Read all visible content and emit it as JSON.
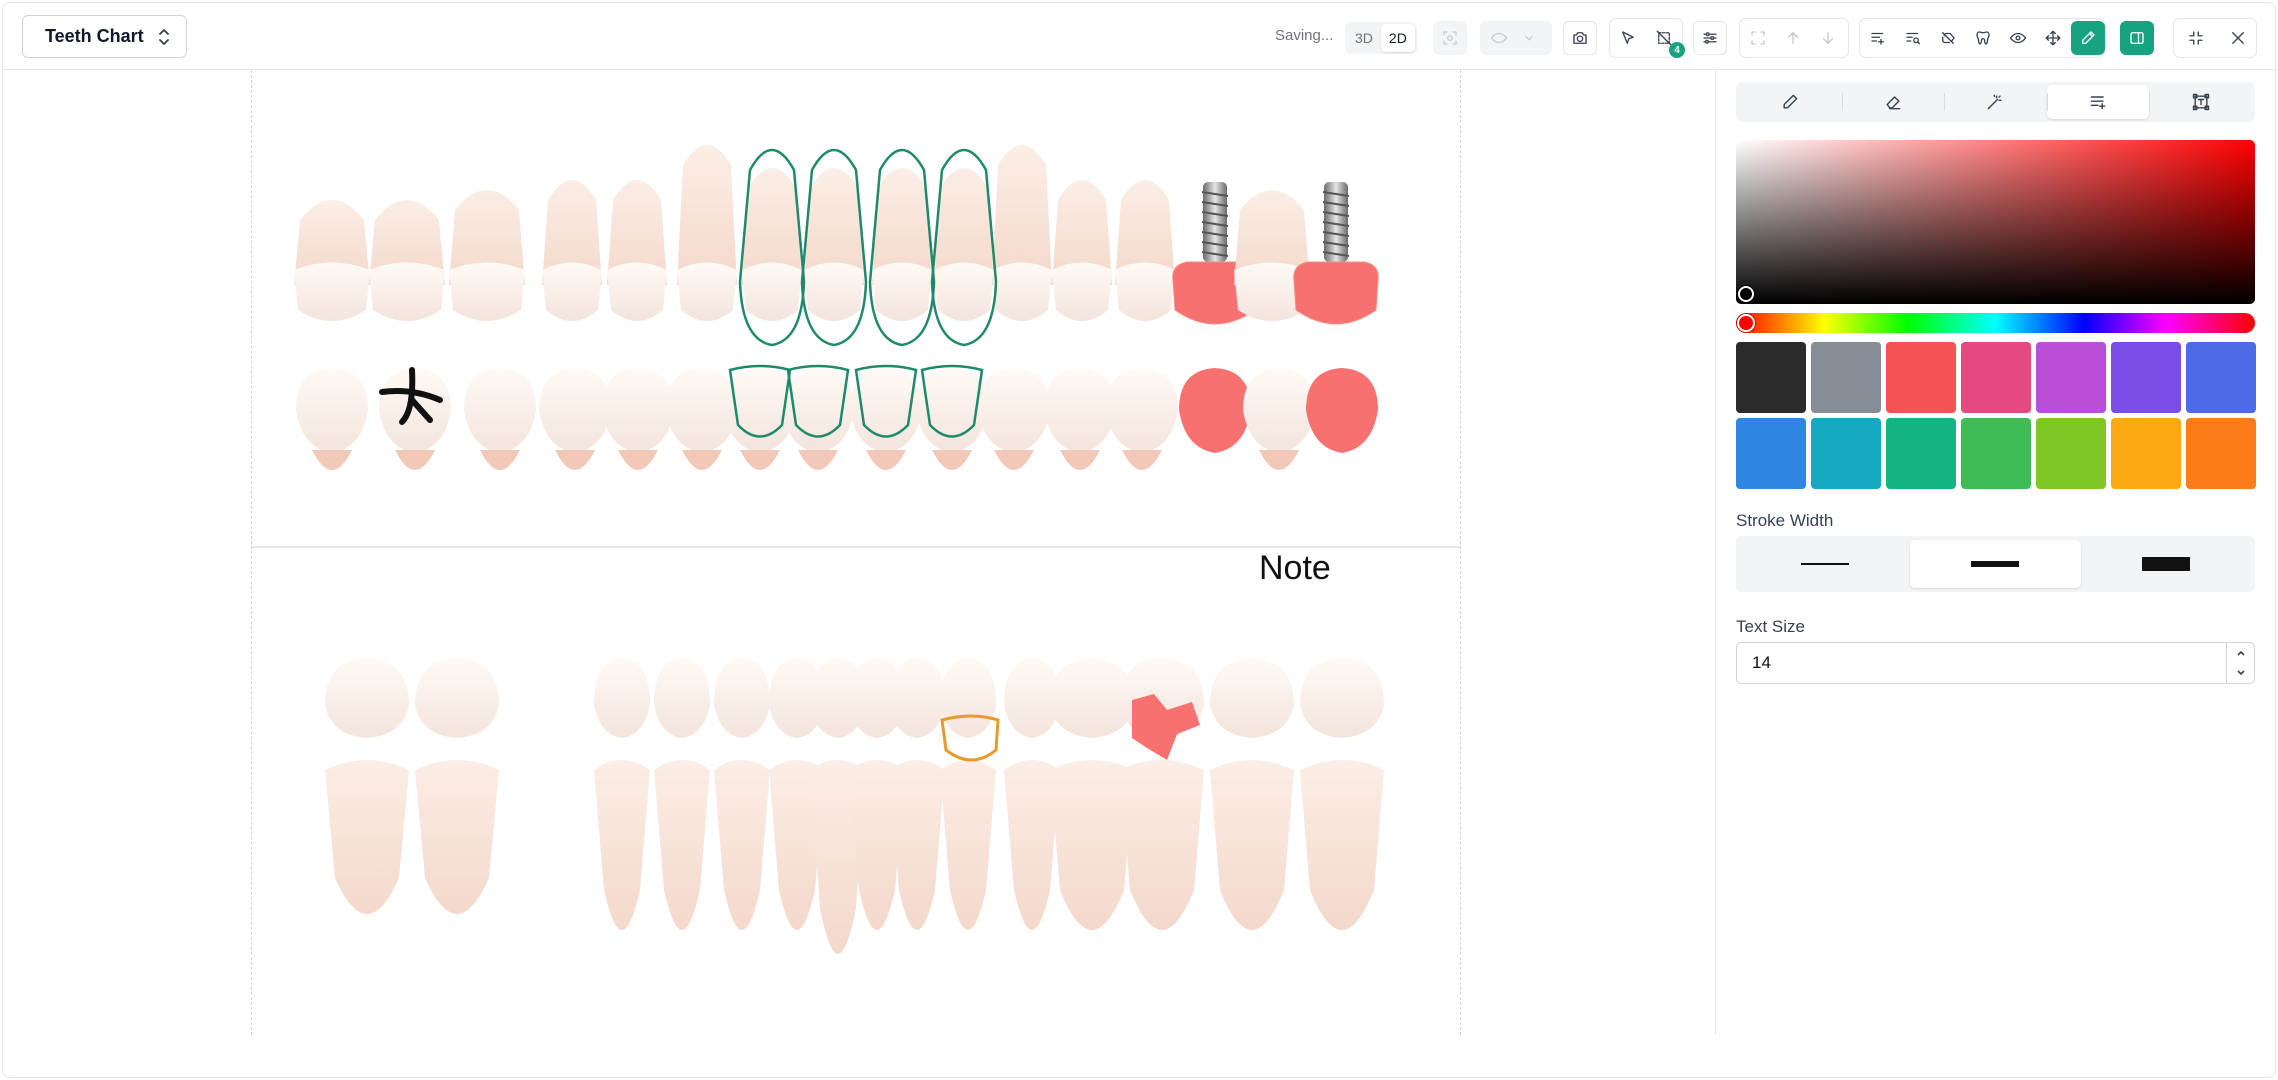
{
  "header": {
    "title": "Teeth Chart",
    "status": "Saving...",
    "view_modes": [
      "3D",
      "2D"
    ],
    "active_view": "2D",
    "selection_count": "4"
  },
  "chart": {
    "note": "Note"
  },
  "panel": {
    "tabs": [
      {
        "name": "pencil-tab",
        "icon": "pencil-icon",
        "active": false
      },
      {
        "name": "eraser-tab",
        "icon": "eraser-icon",
        "active": false
      },
      {
        "name": "magic-wand-tab",
        "icon": "magic-wand-icon",
        "active": false
      },
      {
        "name": "text-list-tab",
        "icon": "text-add-icon",
        "active": true
      },
      {
        "name": "text-box-tab",
        "icon": "text-box-icon",
        "active": false
      }
    ],
    "color_picker": {
      "hue": "#ff0000",
      "selected": "#000000"
    },
    "swatches": [
      "#2b2b2b",
      "#878d95",
      "#f35353",
      "#e4497f",
      "#b84fd6",
      "#7a4ee6",
      "#4d6be9",
      "#2f86e3",
      "#17a9c2",
      "#14b483",
      "#3fbc56",
      "#7ec724",
      "#fbab11",
      "#fa7d1a"
    ],
    "stroke_width_label": "Stroke Width",
    "stroke_widths": [
      "thin",
      "medium",
      "thick"
    ],
    "stroke_active": "medium",
    "text_size_label": "Text Size",
    "text_size": "14"
  }
}
